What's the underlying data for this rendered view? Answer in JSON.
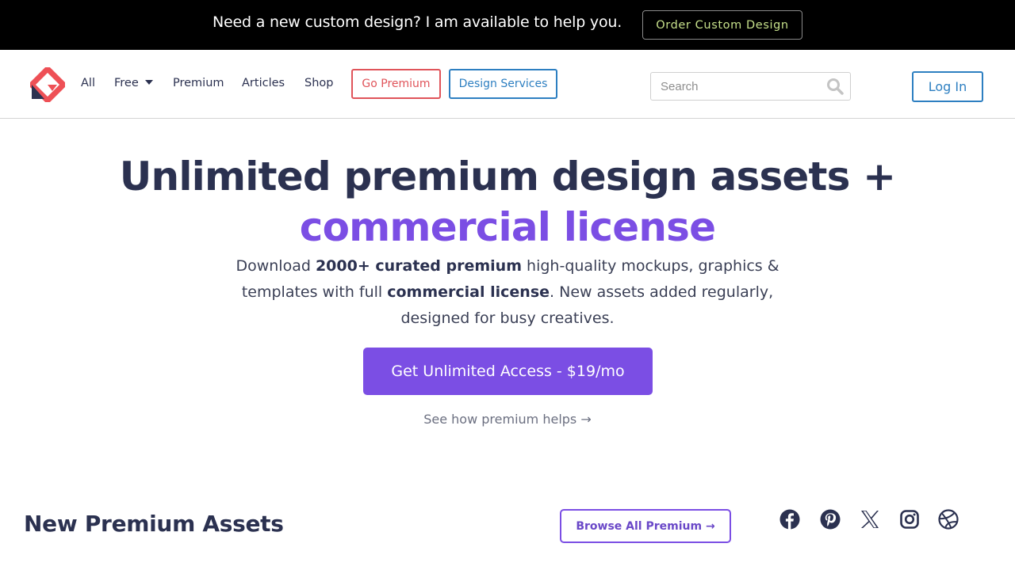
{
  "announcement": {
    "text": "Need a new custom design? I am available to help you.",
    "button_label": "Order Custom Design"
  },
  "header": {
    "logo_icon": "logo-icon",
    "nav": {
      "all": "All",
      "free": "Free",
      "premium": "Premium",
      "articles": "Articles",
      "shop": "Shop"
    },
    "go_premium": "Go Premium",
    "design_services": "Design Services",
    "search": {
      "placeholder": "Search",
      "value": "",
      "icon": "search-icon"
    },
    "login": "Log In"
  },
  "hero": {
    "title_line1": "Unlimited premium design assets +",
    "title_line2": "commercial license",
    "description": {
      "part1": "Download ",
      "bold1": "2000+ curated premium",
      "part2": " high-quality mockups, graphics & templates with full ",
      "bold2": "commercial license",
      "part3": ". New assets added regularly, designed for busy creatives."
    },
    "cta_label": "Get Unlimited Access - $19/mo",
    "secondary_link": "See how premium helps →"
  },
  "section": {
    "title": "New Premium Assets",
    "browse_label": "Browse All Premium →",
    "social_icons": [
      "facebook-icon",
      "pinterest-icon",
      "x-icon",
      "instagram-icon",
      "dribbble-icon"
    ]
  },
  "colors": {
    "accent_purple": "#7b4ee4",
    "brand_red": "#e0545a",
    "link_blue": "#2d7fc1",
    "navy_text": "#2b3150",
    "order_button_text": "#c6e08a"
  }
}
